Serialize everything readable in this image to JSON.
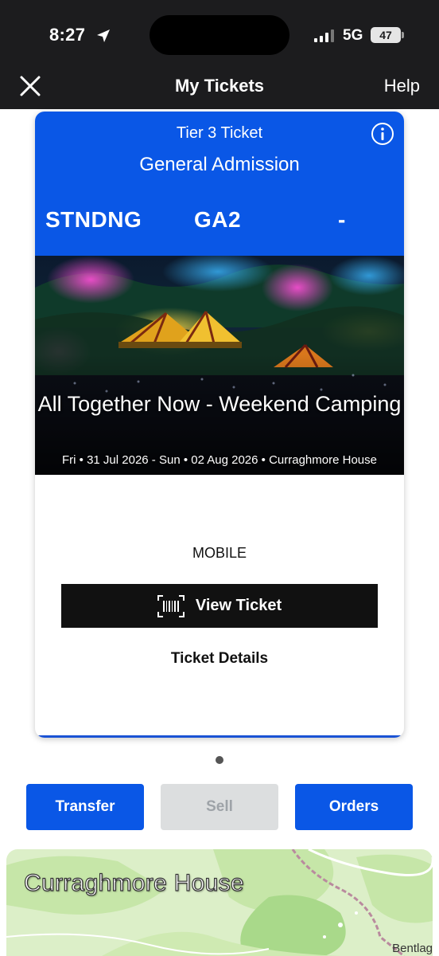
{
  "status_bar": {
    "time": "8:27",
    "network": "5G",
    "battery": "47"
  },
  "nav": {
    "title": "My Tickets",
    "help_label": "Help"
  },
  "ticket": {
    "tier": "Tier 3 Ticket",
    "admission": "General Admission",
    "section": "STNDNG",
    "row": "GA2",
    "seat": "-",
    "event_title": "All Together Now - Weekend Camping",
    "event_meta": "Fri • 31 Jul 2026 - Sun • 02 Aug 2026 • Curraghmore House",
    "delivery_method": "MOBILE",
    "view_ticket_label": "View Ticket",
    "details_label": "Ticket Details"
  },
  "actions": {
    "transfer_label": "Transfer",
    "sell_label": "Sell",
    "orders_label": "Orders"
  },
  "map": {
    "venue_name": "Curraghmore House",
    "place_label": "Bentlag"
  },
  "colors": {
    "brand_blue": "#0a57e6",
    "top_bar": "#1c1c1e",
    "button_dark": "#111111",
    "disabled": "#dcdedf"
  },
  "icons": [
    "location-arrow-icon",
    "signal-icon",
    "close-icon",
    "info-icon",
    "barcode-icon"
  ]
}
